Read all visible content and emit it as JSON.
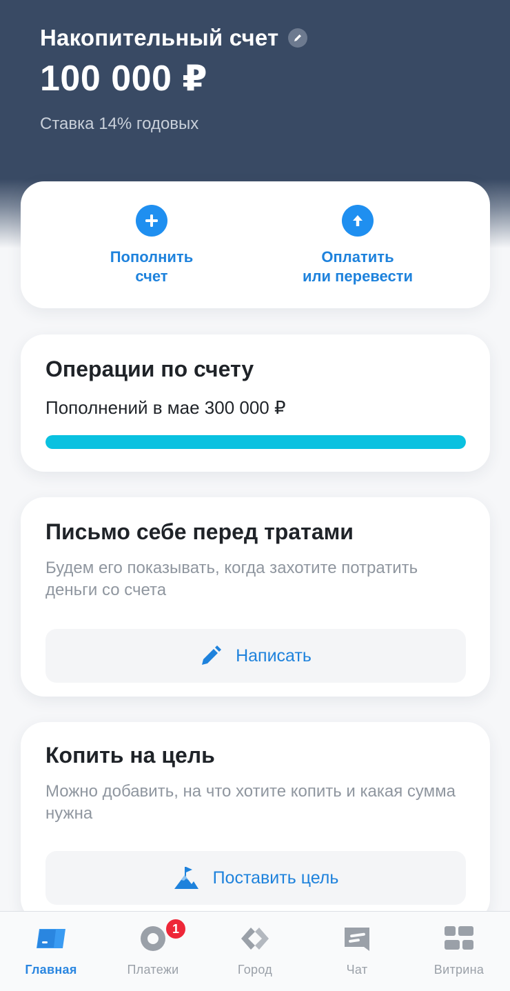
{
  "header": {
    "title": "Накопительный счет",
    "balance": "100 000 ₽",
    "rate": "Ставка 14% годовых"
  },
  "actions": [
    {
      "label": "Пополнить\nсчет",
      "icon": "plus-icon"
    },
    {
      "label": "Оплатить\nили перевести",
      "icon": "arrow-up-icon"
    }
  ],
  "operations": {
    "title": "Операции по счету",
    "subtitle": "Пополнений в мае 300 000 ₽",
    "progress": 1.0,
    "progress_color": "#0ac1e0"
  },
  "letter": {
    "title": "Письмо себе перед тратами",
    "description": "Будем его показывать, когда захотите потратить деньги со счета",
    "button_label": "Написать"
  },
  "goal": {
    "title": "Копить на цель",
    "description": "Можно добавить, на что хотите копить и какая сумма нужна",
    "button_label": "Поставить цель"
  },
  "tabbar": {
    "tabs": [
      {
        "label": "Главная",
        "icon": "card-icon",
        "active": true
      },
      {
        "label": "Платежи",
        "icon": "payments-icon",
        "badge": "1"
      },
      {
        "label": "Город",
        "icon": "city-icon"
      },
      {
        "label": "Чат",
        "icon": "chat-icon"
      },
      {
        "label": "Витрина",
        "icon": "showcase-icon"
      }
    ]
  },
  "colors": {
    "header_bg": "#394a64",
    "accent": "#1e82dc",
    "badge": "#ee2738"
  }
}
